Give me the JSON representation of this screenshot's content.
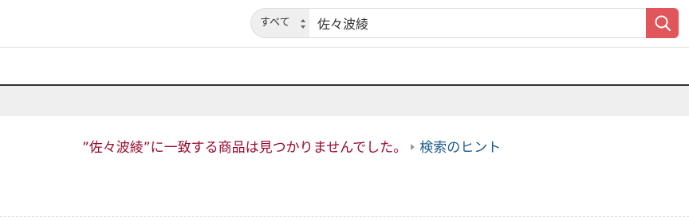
{
  "search": {
    "category_label": "すべて",
    "query_value": "佐々波綾",
    "button_color": "#e0565a"
  },
  "results": {
    "no_results_message": "”佐々波綾”に一致する商品は見つかりませんでした。",
    "hint_link_label": "検索のヒント",
    "message_color": "#990a2c",
    "link_color": "#1e5a8f"
  }
}
